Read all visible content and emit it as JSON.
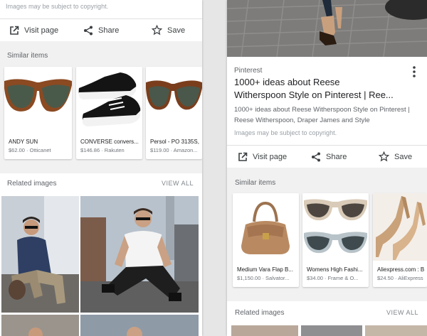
{
  "left": {
    "copyright": "Images may be subject to copyright.",
    "actions": {
      "visit": "Visit page",
      "share": "Share",
      "save": "Save"
    },
    "similar_title": "Similar items",
    "items": [
      {
        "name": "ANDY SUN",
        "meta": "$62.00 · Otticanet"
      },
      {
        "name": "CONVERSE convers...",
        "meta": "$146.86 · Rakuten"
      },
      {
        "name": "Persol - PO 3135S,",
        "meta": "$119.00 · Amazon..."
      }
    ],
    "related_title": "Related images",
    "view_all": "VIEW ALL"
  },
  "right": {
    "source": "Pinterest",
    "title": "1000+ ideas about Reese Witherspoon Style on Pinterest | Ree...",
    "description": "1000+ ideas about Reese Witherspoon Style on Pinterest | Reese Witherspoon, Draper James and Style",
    "copyright": "Images may be subject to copyright.",
    "actions": {
      "visit": "Visit page",
      "share": "Share",
      "save": "Save"
    },
    "similar_title": "Similar items",
    "items": [
      {
        "name": "Medium Vara Flap B...",
        "meta": "$1,150.00 · Salvator..."
      },
      {
        "name": "Womens High Fashi...",
        "meta": "$34.00 · Frame & O..."
      },
      {
        "name": "Aliexpress.com : B",
        "meta": "$24.50 · AliExpress"
      }
    ],
    "related_title": "Related images",
    "view_all": "VIEW ALL"
  }
}
